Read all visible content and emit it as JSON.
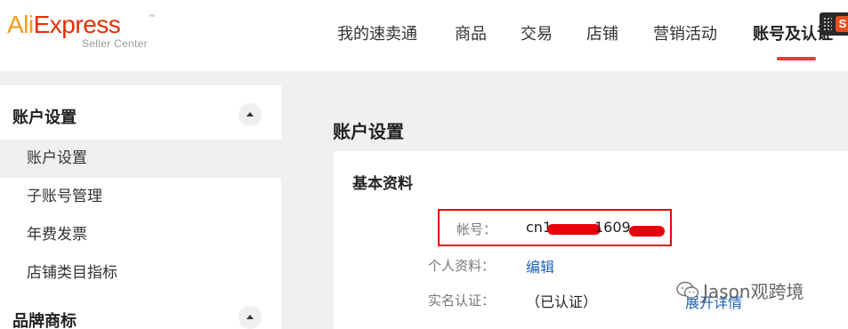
{
  "header": {
    "logo": {
      "part1": "Ali",
      "part2": "Express",
      "tm": "™",
      "subtitle": "Seller Center"
    },
    "nav": [
      {
        "label": "我的速卖通"
      },
      {
        "label": "商品"
      },
      {
        "label": "交易"
      },
      {
        "label": "店铺"
      },
      {
        "label": "营销活动"
      },
      {
        "label": "账号及认证",
        "active": true
      }
    ],
    "corner_badge": "S"
  },
  "sidebar": {
    "groups": [
      {
        "title": "账户设置",
        "expanded": true,
        "items": [
          {
            "label": "账户设置",
            "active": true
          },
          {
            "label": "子账号管理"
          },
          {
            "label": "年费发票"
          },
          {
            "label": "店铺类目指标"
          }
        ]
      },
      {
        "title": "品牌商标",
        "expanded": true,
        "items": []
      }
    ]
  },
  "main": {
    "page_title": "账户设置",
    "card": {
      "title": "基本资料",
      "fields": [
        {
          "label": "帐号：",
          "value_prefix": "cn1",
          "value_mid": "1609",
          "redacted": true
        },
        {
          "label": "个人资料：",
          "link": "编辑"
        },
        {
          "label": "实名认证：",
          "value": "（已认证）",
          "link": "展开详情"
        }
      ]
    }
  },
  "watermark": {
    "text": "Jason观跨境"
  },
  "colors": {
    "logo_orange": "#f59a1a",
    "logo_red": "#e62e04",
    "nav_underline": "#e83a3a",
    "link_blue": "#1f62b8",
    "highlight_red": "#e00b0b"
  }
}
